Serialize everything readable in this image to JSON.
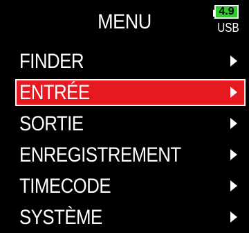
{
  "header": {
    "title": "MENU",
    "battery_level": "4.9",
    "power_source": "USB"
  },
  "colors": {
    "background": "#000000",
    "text": "#ffffff",
    "selection": "#e5191f",
    "battery": "#2fc82f"
  },
  "menu": {
    "selected_index": 1,
    "items": [
      {
        "label": "FINDER",
        "icon": "chevron-right-icon"
      },
      {
        "label": "ENTRÉE",
        "icon": "chevron-right-icon"
      },
      {
        "label": "SORTIE",
        "icon": "chevron-right-icon"
      },
      {
        "label": "ENREGISTREMENT",
        "icon": "chevron-right-icon"
      },
      {
        "label": "TIMECODE",
        "icon": "chevron-right-icon"
      },
      {
        "label": "SYSTÈME",
        "icon": "chevron-right-icon"
      }
    ]
  }
}
